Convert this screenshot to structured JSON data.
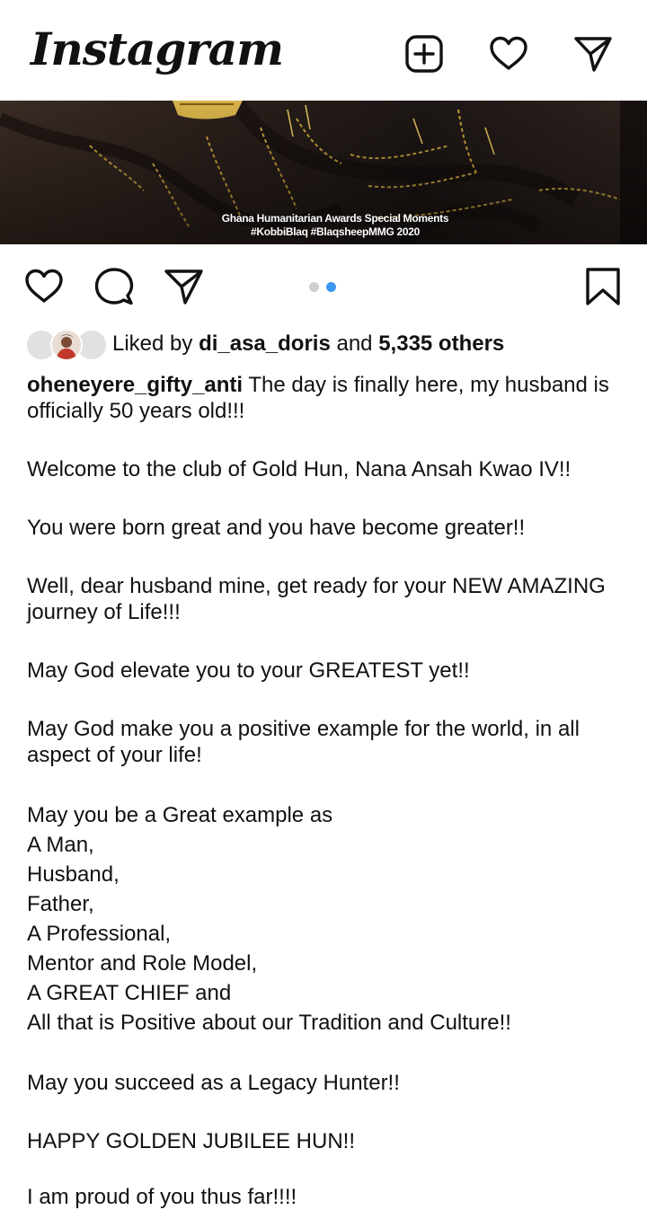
{
  "app": {
    "logo_text": "Instagram"
  },
  "header": {
    "icons": [
      "add-post-icon",
      "heart-icon",
      "direct-message-icon"
    ]
  },
  "media": {
    "caption_line1": "Ghana Humanitarian Awards Special Moments",
    "caption_line2": "#KobbiBlaq #BlaqsheepMMG 2020",
    "carousel_count": 2,
    "carousel_active_index": 1,
    "colors": {
      "dot_inactive": "#cfcfcf",
      "dot_active": "#3b97f0"
    }
  },
  "actions": {
    "icons": [
      "like-icon",
      "comment-icon",
      "share-icon",
      "save-icon"
    ]
  },
  "likes": {
    "prefix": "Liked by",
    "user": "di_asa_doris",
    "connector": "and",
    "others": "5,335 others"
  },
  "post": {
    "username": "oheneyere_gifty_anti",
    "first_line": "The day is finally here, my husband is officially 50 years old!!!",
    "paragraphs": [
      "Welcome to the club of Gold Hun, Nana Ansah Kwao IV!!",
      "You were born great and you have become greater!!",
      "Well, dear husband mine, get ready for your NEW AMAZING journey of Life!!!",
      "May God elevate you to your GREATEST yet!!",
      "May God make you a positive example for the world, in all aspect of your life!"
    ],
    "list_lines": [
      "May you be a Great example as",
      "A Man,",
      "Husband,",
      "Father,",
      "A Professional,",
      "Mentor and Role Model,",
      "A GREAT CHIEF and",
      "All that is Positive about our Tradition and Culture!!"
    ],
    "closing": [
      "May you succeed as a Legacy Hunter!!",
      "HAPPY GOLDEN JUBILEE HUN!!"
    ],
    "cut_line": "I am proud of you thus far!!!!"
  }
}
